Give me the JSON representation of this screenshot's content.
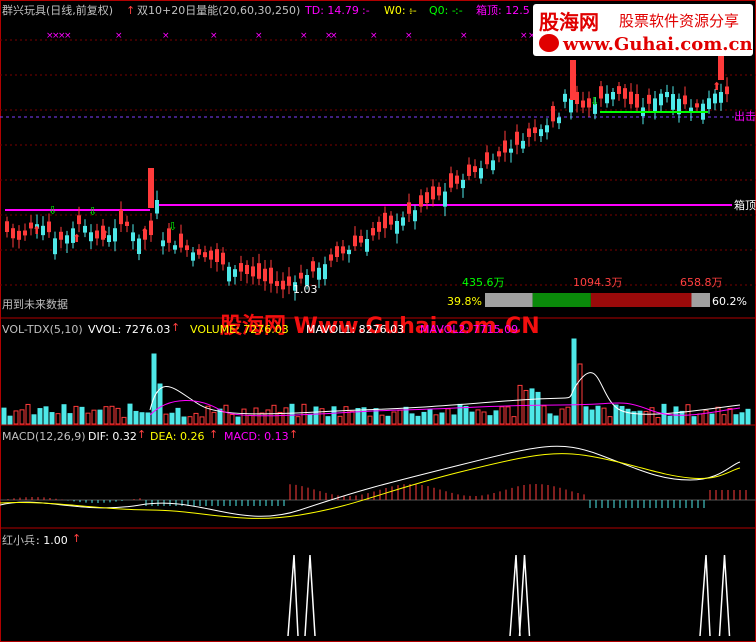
{
  "header": {
    "title": "群兴玩具(日线,前复权)",
    "indicator_name": "双10+20日量能(20,60,30,250)",
    "td": "TD: 14.79",
    "td_sep": ":-",
    "w0": "W0: -",
    "w0_sep": ":-",
    "q0": "Q0: -",
    "q0_sep": ":-",
    "box_top": "箱顶: 12.5"
  },
  "logo": {
    "big": "股海网",
    "sub": "股票软件资源分享",
    "url": "www.Guhai.com.cn"
  },
  "watermark": "股海网 Www.Guhai.com.CN",
  "price_pane": {
    "label_exit": "出击",
    "label_box": "箱顶",
    "low_price": "1.03",
    "future_data_note": "用到未来数据",
    "vol_labels": [
      "435.6万",
      "1094.3万",
      "658.8万"
    ],
    "pct_labels": [
      "39.8%",
      "60.2%"
    ],
    "bar_segments": [
      0.18,
      0.22,
      0.38,
      0.07
    ]
  },
  "vol_pane": {
    "name": "VOL-TDX(5,10)",
    "vvol": "VVOL: 7276.03",
    "volume": "VOLUME: 7276.03",
    "mavol1": "MAVOL1: 8276.03",
    "mavol2": "MAVOL2: 7715.09"
  },
  "macd_pane": {
    "name": "MACD(12,26,9)",
    "dif": "DIF: 0.32",
    "dea": "DEA: 0.26",
    "macd": "MACD: 0.13"
  },
  "signal_pane": {
    "name": "红小兵",
    "value": ": 1.00"
  },
  "colors": {
    "up": "#ff3b3b",
    "down": "#4ee8e8",
    "magenta": "#ff00ff",
    "yellow": "#ffff00",
    "green": "#00ff00",
    "grid": "#7a0000"
  }
}
